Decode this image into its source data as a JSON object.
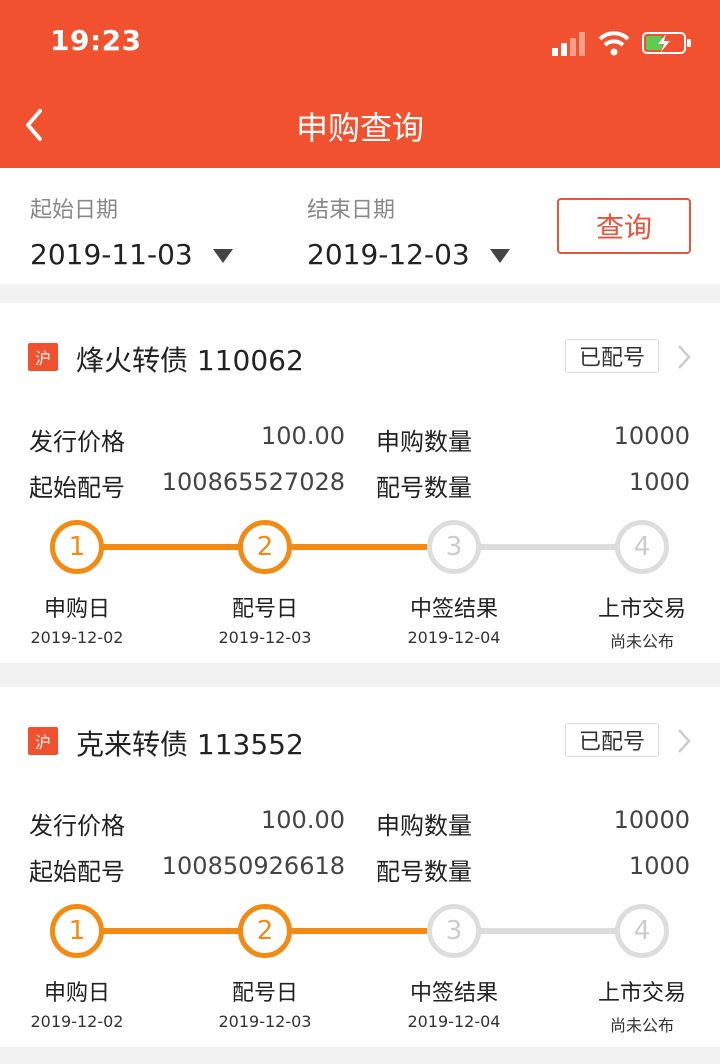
{
  "status_bar": {
    "time": "19:23"
  },
  "nav": {
    "title": "申购查询"
  },
  "filter": {
    "start_label": "起始日期",
    "start_value": "2019-11-03",
    "end_label": "结束日期",
    "end_value": "2019-12-03",
    "query_label": "查询"
  },
  "colors": {
    "brand": "#f2512f",
    "accent": "#f28a14",
    "inactive": "#dddddd"
  },
  "field_labels": {
    "issue_price": "发行价格",
    "sub_qty": "申购数量",
    "start_no": "起始配号",
    "alloc_qty": "配号数量"
  },
  "bonds": [
    {
      "market": "沪",
      "name": "烽火转债 110062",
      "status": "已配号",
      "issue_price": "100.00",
      "sub_qty": "10000",
      "start_no": "100865527028",
      "alloc_qty": "1000",
      "progress_completed": 2,
      "steps": [
        {
          "num": "1",
          "label": "申购日",
          "date": "2019-12-02"
        },
        {
          "num": "2",
          "label": "配号日",
          "date": "2019-12-03"
        },
        {
          "num": "3",
          "label": "中签结果",
          "date": "2019-12-04"
        },
        {
          "num": "4",
          "label": "上市交易",
          "date": "尚未公布"
        }
      ]
    },
    {
      "market": "沪",
      "name": "克来转债 113552",
      "status": "已配号",
      "issue_price": "100.00",
      "sub_qty": "10000",
      "start_no": "100850926618",
      "alloc_qty": "1000",
      "progress_completed": 2,
      "steps": [
        {
          "num": "1",
          "label": "申购日",
          "date": "2019-12-02"
        },
        {
          "num": "2",
          "label": "配号日",
          "date": "2019-12-03"
        },
        {
          "num": "3",
          "label": "中签结果",
          "date": "2019-12-04"
        },
        {
          "num": "4",
          "label": "上市交易",
          "date": "尚未公布"
        }
      ]
    }
  ]
}
